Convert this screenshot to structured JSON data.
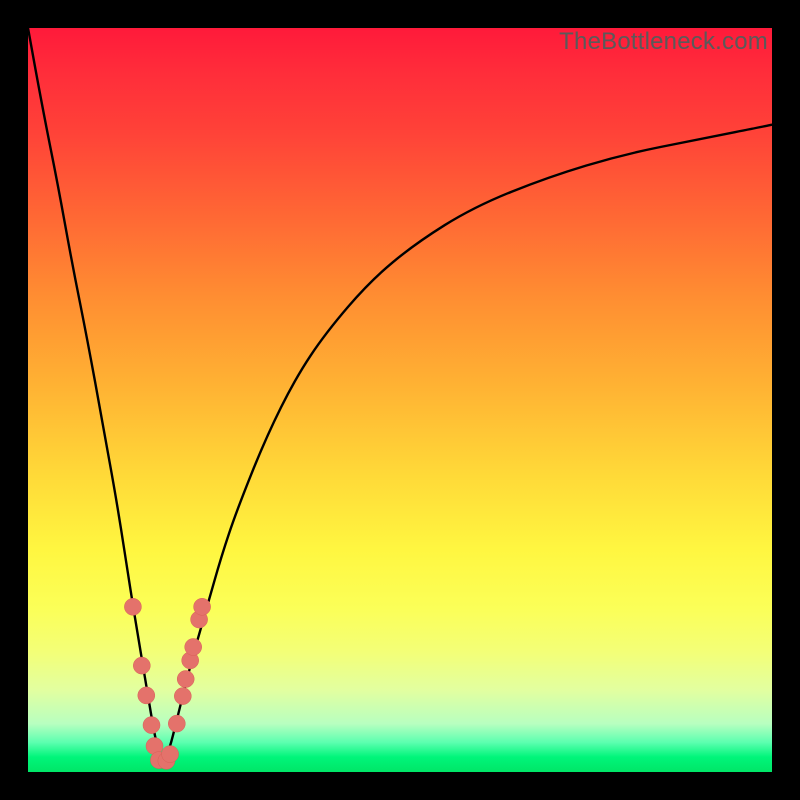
{
  "watermark": "TheBottleneck.com",
  "colors": {
    "frame": "#000000",
    "curve": "#000000",
    "dot_fill": "#e4726b",
    "dot_stroke": "#d85f58",
    "gradient_top": "#ff1a3a",
    "gradient_bottom": "#00e667"
  },
  "chart_data": {
    "type": "line",
    "title": "",
    "xlabel": "",
    "ylabel": "",
    "xlim": [
      0,
      100
    ],
    "ylim": [
      0,
      100
    ],
    "note": "Axes are unlabeled; values below are estimated in percent of plot area (0=left/bottom, 100=right/top). The curve is a V-shaped bottleneck curve with minimum near x≈18. Dots mark highlighted sample points on the curve.",
    "series": [
      {
        "name": "bottleneck-curve",
        "x": [
          0,
          2,
          4,
          6,
          8,
          10,
          12,
          14,
          15,
          16,
          17,
          18,
          19,
          20,
          21,
          22,
          24,
          26,
          28,
          32,
          36,
          40,
          46,
          52,
          60,
          70,
          80,
          90,
          100
        ],
        "y": [
          100,
          89,
          79,
          68,
          58,
          47,
          36,
          23,
          17,
          11,
          5,
          0.7,
          3,
          7,
          11,
          15,
          22,
          29,
          35,
          45,
          53,
          59,
          66,
          71,
          76,
          80,
          83,
          85,
          87
        ]
      }
    ],
    "dots": {
      "name": "highlighted-points",
      "points": [
        {
          "x": 14.1,
          "y": 22.2
        },
        {
          "x": 15.3,
          "y": 14.3
        },
        {
          "x": 15.9,
          "y": 10.3
        },
        {
          "x": 16.6,
          "y": 6.3
        },
        {
          "x": 17.0,
          "y": 3.5
        },
        {
          "x": 17.6,
          "y": 1.6
        },
        {
          "x": 18.6,
          "y": 1.5
        },
        {
          "x": 19.1,
          "y": 2.4
        },
        {
          "x": 20.0,
          "y": 6.5
        },
        {
          "x": 20.8,
          "y": 10.2
        },
        {
          "x": 21.2,
          "y": 12.5
        },
        {
          "x": 21.8,
          "y": 15.0
        },
        {
          "x": 22.2,
          "y": 16.8
        },
        {
          "x": 23.0,
          "y": 20.5
        },
        {
          "x": 23.4,
          "y": 22.2
        }
      ]
    }
  }
}
